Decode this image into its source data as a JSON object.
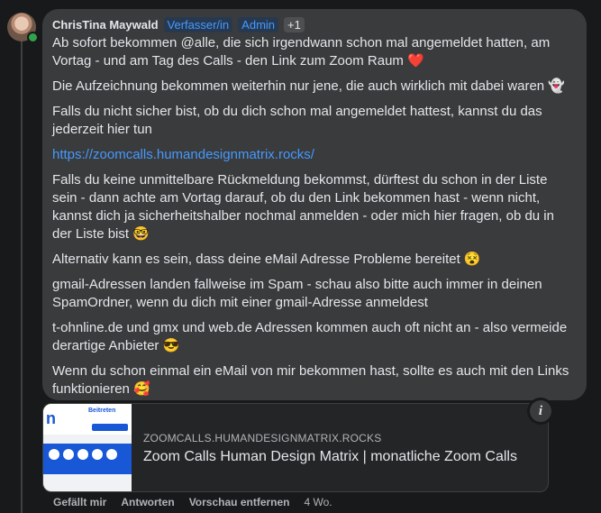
{
  "comment": {
    "author": "ChrisTina Maywald",
    "badges": [
      "Verfasser/in",
      "Admin",
      "+1"
    ],
    "paragraphs": [
      "Ab sofort bekommen @alle, die sich irgendwann schon mal angemeldet hatten, am Vortag - und am Tag des Calls - den Link zum Zoom Raum ❤️",
      "Die Aufzeichnung bekommen weiterhin nur jene, die auch wirklich mit dabei waren 👻",
      "Falls du nicht sicher bist, ob du dich schon mal angemeldet hattest, kannst du das jederzeit hier tun",
      "Falls du keine unmittelbare Rückmeldung bekommst, dürftest du schon in der Liste sein - dann achte am Vortag darauf, ob du den Link bekommen hast - wenn nicht, kannst dich ja sicherheitshalber nochmal anmelden - oder mich hier fragen, ob du in der Liste bist 🤓",
      "Alternativ kann es sein, dass deine eMail Adresse Probleme bereitet 😵",
      "gmail-Adressen landen fallweise im Spam - schau also bitte auch immer in deinen SpamOrdner, wenn du dich mit einer gmail-Adresse anmeldest",
      "t-ohnline.de und gmx und web.de Adressen kommen auch oft nicht an - also vermeide derartige Anbieter 😎",
      "Wenn du schon einmal ein eMail von mir bekommen hast, sollte es auch mit den Links funktionieren 🥰"
    ],
    "link": "https://zoomcalls.humandesignmatrix.rocks/"
  },
  "preview": {
    "domain": "ZOOMCALLS.HUMANDESIGNMATRIX.ROCKS",
    "title": "Zoom Calls Human Design Matrix | monatliche Zoom Calls",
    "thumb_logo": "n",
    "thumb_button": "Beitreten"
  },
  "actions": {
    "like": "Gefällt mir",
    "reply": "Antworten",
    "remove_preview": "Vorschau entfernen",
    "time": "4 Wo."
  },
  "icons": {
    "info": "info-icon"
  },
  "colors": {
    "accent": "#4599ff",
    "bubble": "#3a3b3c",
    "background": "#18191a"
  }
}
